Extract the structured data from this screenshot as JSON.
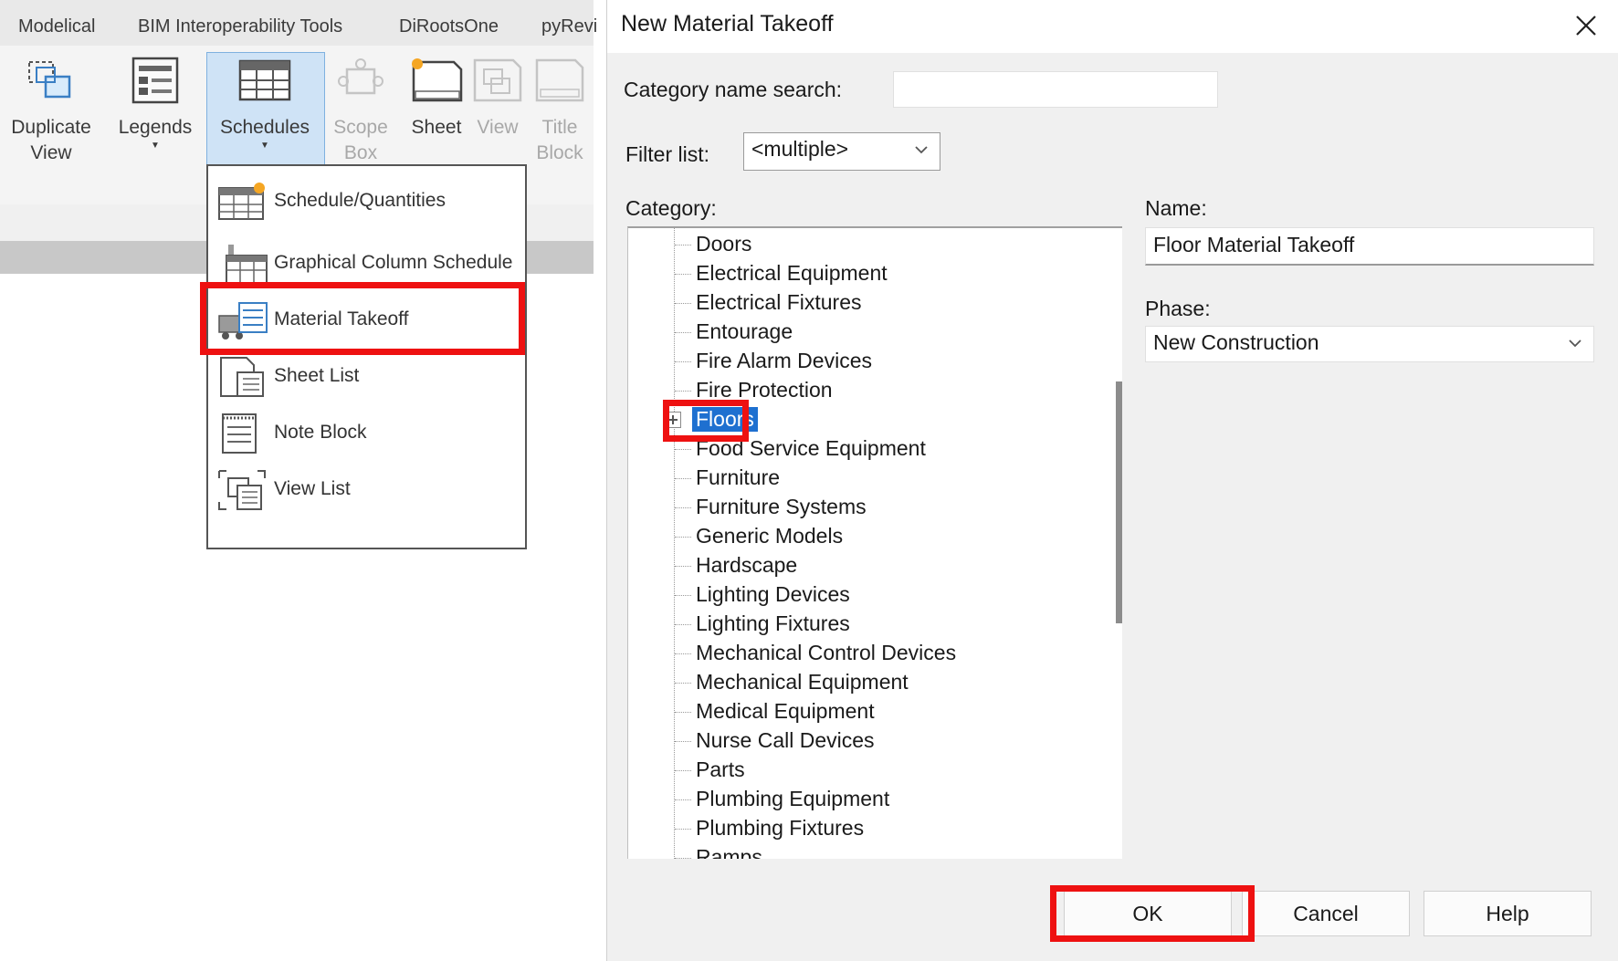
{
  "ribbon": {
    "tabs": [
      "Modelical",
      "BIM Interoperability Tools",
      "DiRootsOne",
      "pyRevi"
    ],
    "buttons": {
      "duplicate_view": {
        "line1": "Duplicate",
        "line2": "View"
      },
      "legends": "Legends",
      "schedules": "Schedules",
      "scope_box": {
        "line1": "Scope",
        "line2": "Box"
      },
      "sheet": "Sheet",
      "view": "View",
      "title_block": {
        "line1": "Title",
        "line2": "Block"
      }
    },
    "schedules_menu": [
      "Schedule/Quantities",
      "Graphical Column Schedule",
      "Material Takeoff",
      "Sheet List",
      "Note Block",
      "View List"
    ]
  },
  "dialog": {
    "title": "New Material Takeoff",
    "category_search_label": "Category name search:",
    "category_search_value": "",
    "filter_label": "Filter list:",
    "filter_value": "<multiple>",
    "category_label": "Category:",
    "categories": [
      "Doors",
      "Electrical Equipment",
      "Electrical Fixtures",
      "Entourage",
      "Fire Alarm Devices",
      "Fire Protection",
      "Floors",
      "Food Service Equipment",
      "Furniture",
      "Furniture Systems",
      "Generic Models",
      "Hardscape",
      "Lighting Devices",
      "Lighting Fixtures",
      "Mechanical Control Devices",
      "Mechanical Equipment",
      "Medical Equipment",
      "Nurse Call Devices",
      "Parts",
      "Plumbing Equipment",
      "Plumbing Fixtures",
      "Ramps"
    ],
    "selected_category": "Floors",
    "name_label": "Name:",
    "name_value": "Floor Material Takeoff",
    "phase_label": "Phase:",
    "phase_value": "New Construction",
    "buttons": {
      "ok": "OK",
      "cancel": "Cancel",
      "help": "Help"
    }
  },
  "colors": {
    "highlight_red": "#ee1111",
    "selection_blue": "#1e70d0",
    "ribbon_active": "#cfe3f6"
  }
}
